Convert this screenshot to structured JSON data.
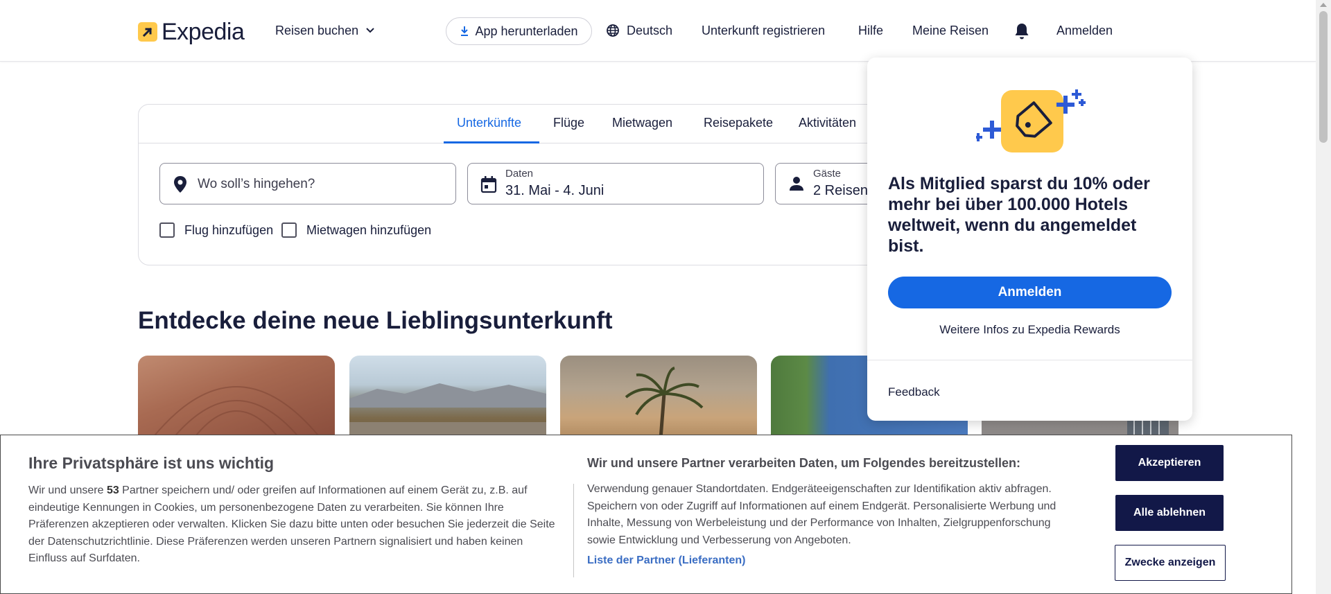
{
  "header": {
    "logo_text": "Expedia",
    "reisen_buchen": "Reisen buchen",
    "app_download": "App herunterladen",
    "language": "Deutsch",
    "register_property": "Unterkunft registrieren",
    "help": "Hilfe",
    "my_trips": "Meine Reisen",
    "sign_in": "Anmelden"
  },
  "search": {
    "tabs": [
      {
        "label": "Unterkünfte",
        "active": true
      },
      {
        "label": "Flüge"
      },
      {
        "label": "Mietwagen"
      },
      {
        "label": "Reisepakete"
      },
      {
        "label": "Aktivitäten"
      }
    ],
    "destination_placeholder": "Wo soll’s hingehen?",
    "dates_label": "Daten",
    "dates_value": "31. Mai - 4. Juni",
    "guests_label": "Gäste",
    "guests_value": "2 Reisende",
    "add_flight": "Flug hinzufügen",
    "add_car": "Mietwagen hinzufügen"
  },
  "section_title": "Entdecke deine neue Lieblingsunterkunft",
  "popover": {
    "text": "Als Mitglied sparst du 10% oder mehr bei über 100.000 Hotels weltweit, wenn du angemeldet bist.",
    "button": "Anmelden",
    "link": "Weitere Infos zu Expedia Rewards",
    "feedback": "Feedback"
  },
  "cookie": {
    "title": "Ihre Privatsphäre ist uns wichtig",
    "body_prefix": "Wir und unsere ",
    "partner_count": "53",
    "body_suffix": " Partner speichern und/ oder greifen auf Informationen auf einem Gerät zu, z.B. auf eindeutige Kennungen in Cookies, um personenbezogene Daten zu verarbeiten. Sie können Ihre Präferenzen akzeptieren oder verwalten. Klicken Sie dazu bitte unten oder besuchen Sie jederzeit die Seite der Datenschutzrichtlinie. Diese Präferenzen werden unseren Partnern signalisiert und haben keinen Einfluss auf Surfdaten.",
    "title2": "Wir und unsere Partner verarbeiten Daten, um Folgendes bereitzustellen:",
    "body2": "Verwendung genauer Standortdaten. Endgeräteeigenschaften zur Identifikation aktiv abfragen. Speichern von oder Zugriff auf Informationen auf einem Endgerät. Personalisierte Werbung und Inhalte, Messung von Werbeleistung und der Performance von Inhalten, Zielgruppenforschung sowie Entwicklung und Verbesserung von Angeboten.",
    "partner_list": "Liste der Partner (Lieferanten)",
    "accept": "Akzeptieren",
    "reject": "Alle ablehnen",
    "purposes": "Zwecke anzeigen"
  },
  "colors": {
    "brand_blue": "#1668e3",
    "brand_yellow": "#ffc94c",
    "navy": "#191e3b",
    "cookie_button": "#121848"
  }
}
